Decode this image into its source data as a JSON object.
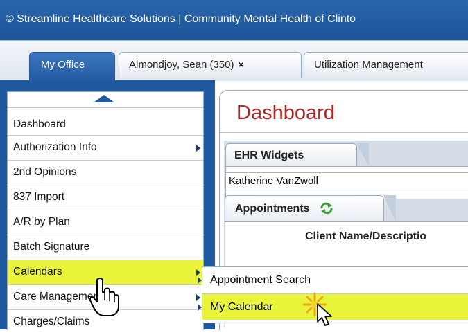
{
  "banner": {
    "text": "© Streamline Healthcare Solutions | Community Mental Health of Clinto"
  },
  "tabs": [
    {
      "label": "My Office",
      "active": true
    },
    {
      "label": "Almondjoy, Sean (350)",
      "close": "×"
    },
    {
      "label": "Utilization Management"
    }
  ],
  "left_menu": {
    "items": [
      {
        "label": "Dashboard"
      },
      {
        "label": "Authorization Info",
        "submenu": true
      },
      {
        "label": "2nd Opinions"
      },
      {
        "label": "837 Import"
      },
      {
        "label": "A/R by Plan"
      },
      {
        "label": "Batch Signature"
      },
      {
        "label": "Calendars",
        "submenu": true,
        "highlighted": true
      },
      {
        "label": "Care Management",
        "submenu": true
      },
      {
        "label": "Charges/Claims"
      }
    ]
  },
  "calendars_submenu": {
    "items": [
      {
        "label": "Appointment Search"
      },
      {
        "label": "My Calendar",
        "highlighted": true
      }
    ]
  },
  "dashboard": {
    "title": "Dashboard",
    "widget_tab": "EHR Widgets",
    "user_name": "Katherine VanZwoll",
    "appointments_tab": "Appointments",
    "column_header": "Client Name/Descriptio"
  },
  "colors": {
    "banner_blue": "#1d5398",
    "highlight_yellow": "#e9f53b",
    "title_red": "#b02525",
    "refresh_green": "#3aa335"
  }
}
